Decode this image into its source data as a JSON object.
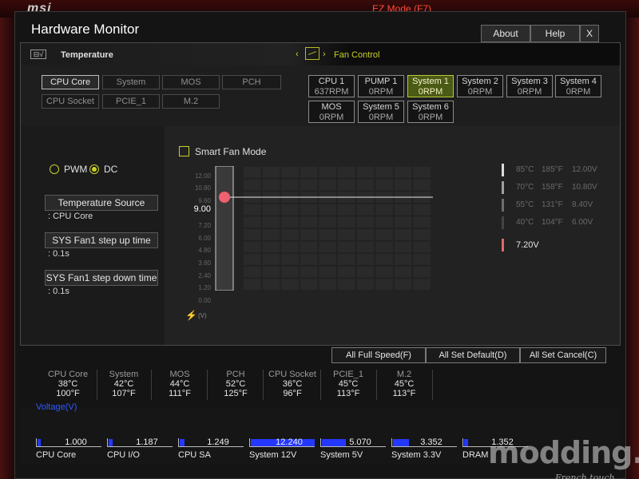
{
  "background": {
    "logo": "msi",
    "ez_mode": "EZ Mode (F7)"
  },
  "window": {
    "title": "Hardware Monitor",
    "buttons": {
      "about": "About",
      "help": "Help",
      "close": "X"
    }
  },
  "temperature": {
    "title": "Temperature",
    "icon": "thermometer-icon",
    "sources": [
      {
        "label": "CPU Core",
        "active": true
      },
      {
        "label": "System",
        "active": false
      },
      {
        "label": "MOS",
        "active": false
      },
      {
        "label": "PCH",
        "active": false
      },
      {
        "label": "CPU Socket",
        "active": false
      },
      {
        "label": "PCIE_1",
        "active": false
      },
      {
        "label": "M.2",
        "active": false
      }
    ]
  },
  "fan_control": {
    "title": "Fan Control",
    "fans": [
      {
        "name": "CPU 1",
        "rpm": "637RPM",
        "active": false
      },
      {
        "name": "PUMP 1",
        "rpm": "0RPM",
        "active": false
      },
      {
        "name": "System 1",
        "rpm": "0RPM",
        "active": true
      },
      {
        "name": "System 2",
        "rpm": "0RPM",
        "active": false
      },
      {
        "name": "System 3",
        "rpm": "0RPM",
        "active": false
      },
      {
        "name": "System 4",
        "rpm": "0RPM",
        "active": false
      },
      {
        "name": "MOS",
        "rpm": "0RPM",
        "active": false
      },
      {
        "name": "System 5",
        "rpm": "0RPM",
        "active": false
      },
      {
        "name": "System 6",
        "rpm": "0RPM",
        "active": false
      }
    ]
  },
  "mode": {
    "pwm": "PWM",
    "dc": "DC",
    "selected": "DC"
  },
  "settings": {
    "temperature_source_label": "Temperature Source",
    "temperature_source_value": ": CPU Core",
    "step_up_label": "SYS Fan1 step up time",
    "step_up_value": ": 0.1s",
    "step_down_label": "SYS Fan1 step down time",
    "step_down_value": ": 0.1s"
  },
  "smart_fan": {
    "label": "Smart Fan Mode",
    "checked": false
  },
  "graph": {
    "y_ticks": [
      "12.00",
      "10.80",
      "9.60",
      "8.40",
      "7.20",
      "6.00",
      "4.80",
      "3.60",
      "2.40",
      "1.20",
      "0.00"
    ],
    "current_value": "9.00",
    "current_value_num": 9.0,
    "y_max": 12.0,
    "unit": "(V)",
    "unit_icon": "lightning-icon"
  },
  "legend": [
    {
      "c": "85°C",
      "f": "185°F",
      "v": "12.00V",
      "color": "#dcdcdc"
    },
    {
      "c": "70°C",
      "f": "158°F",
      "v": "10.80V",
      "color": "#a0a0a0"
    },
    {
      "c": "55°C",
      "f": "131°F",
      "v": "8.40V",
      "color": "#6e6e6e"
    },
    {
      "c": "40°C",
      "f": "104°F",
      "v": "6.00V",
      "color": "#444444"
    }
  ],
  "current_voltage": {
    "value": "7.20V",
    "color": "#e0696a"
  },
  "actions": {
    "full_speed": "All Full Speed(F)",
    "set_default": "All Set Default(D)",
    "set_cancel": "All Set Cancel(C)"
  },
  "readouts": [
    {
      "name": "CPU Core",
      "c": "38°C",
      "f": "100°F"
    },
    {
      "name": "System",
      "c": "42°C",
      "f": "107°F"
    },
    {
      "name": "MOS",
      "c": "44°C",
      "f": "111°F"
    },
    {
      "name": "PCH",
      "c": "52°C",
      "f": "125°F"
    },
    {
      "name": "CPU Socket",
      "c": "36°C",
      "f": "96°F"
    },
    {
      "name": "PCIE_1",
      "c": "45°C",
      "f": "113°F"
    },
    {
      "name": "M.2",
      "c": "45°C",
      "f": "113°F"
    }
  ],
  "voltage": {
    "title": "Voltage(V)",
    "items": [
      {
        "name": "CPU Core",
        "value": "1.000",
        "fill": 0.05
      },
      {
        "name": "CPU I/O",
        "value": "1.187",
        "fill": 0.06
      },
      {
        "name": "CPU SA",
        "value": "1.249",
        "fill": 0.07
      },
      {
        "name": "System 12V",
        "value": "12.240",
        "fill": 1.0
      },
      {
        "name": "System 5V",
        "value": "5.070",
        "fill": 0.38
      },
      {
        "name": "System 3.3V",
        "value": "3.352",
        "fill": 0.25
      },
      {
        "name": "DRAM",
        "value": "1.352",
        "fill": 0.06
      }
    ]
  },
  "watermark": {
    "main": "modding.fr",
    "sub": "French touch"
  }
}
